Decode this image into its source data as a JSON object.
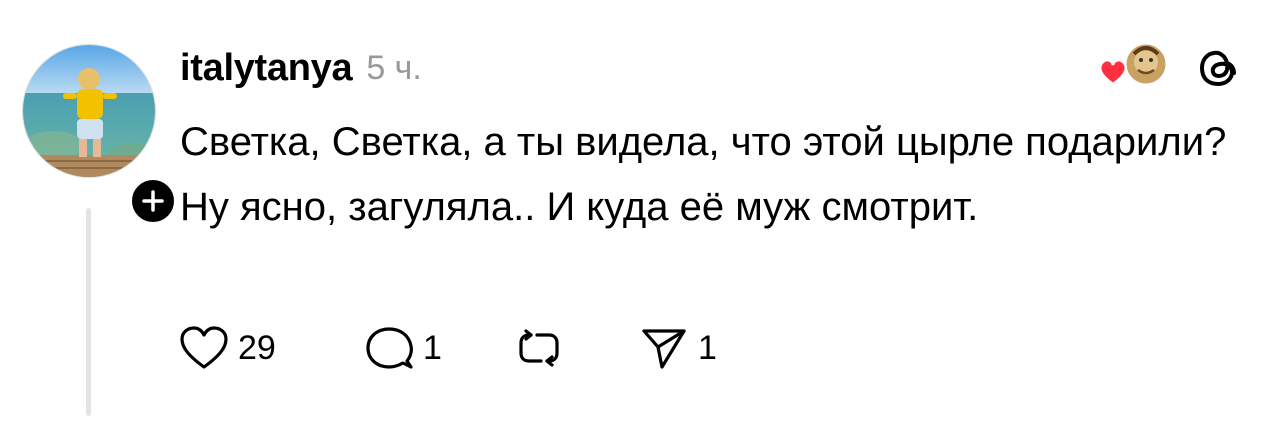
{
  "post": {
    "username": "italytanya",
    "time": "5 ч.",
    "text": "Светка, Светка, а ты видела, что этой цырле подарили? Ну ясно, загуляла.. И куда её муж смотрит.",
    "actions": {
      "like_count": "29",
      "reply_count": "1",
      "share_count": "1"
    }
  },
  "icons": {
    "follow": "plus-icon",
    "reaction_heart": "heart-icon",
    "like": "heart-outline-icon",
    "reply": "comment-icon",
    "repost": "repost-icon",
    "share": "send-icon",
    "app": "threads-logo-icon"
  },
  "colors": {
    "heart_red": "#ff3040",
    "muted_gray": "#999999",
    "thread_line": "#e3e3e3"
  }
}
